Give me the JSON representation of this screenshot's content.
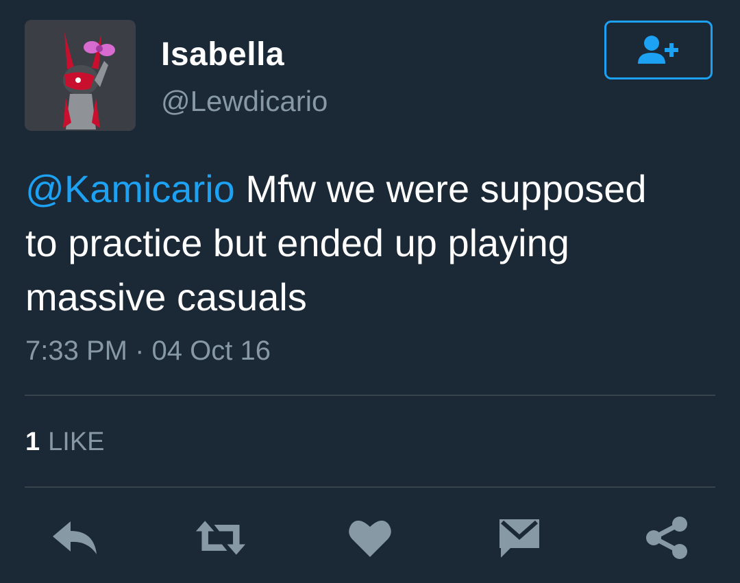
{
  "user": {
    "display_name": "Isabella",
    "handle": "@Lewdicario"
  },
  "follow_button": {
    "icon": "add-user-icon"
  },
  "tweet": {
    "mention": "@Kamicario",
    "line1_rest": " Mfw we were supposed",
    "line2": "to practice but ended up playing",
    "line3": "massive casuals",
    "timestamp": "7:33 PM · 04 Oct 16"
  },
  "stats": {
    "like_count": "1",
    "like_label": "LIKE"
  },
  "actions": [
    {
      "name": "reply",
      "icon": "reply-icon"
    },
    {
      "name": "retweet",
      "icon": "retweet-icon"
    },
    {
      "name": "like",
      "icon": "heart-icon"
    },
    {
      "name": "message",
      "icon": "envelope-icon"
    },
    {
      "name": "share",
      "icon": "share-icon"
    }
  ],
  "colors": {
    "background": "#1b2836",
    "accent": "#1da1f2",
    "muted": "#8899a6",
    "divider": "#38444d",
    "icon": "#8899a6"
  }
}
